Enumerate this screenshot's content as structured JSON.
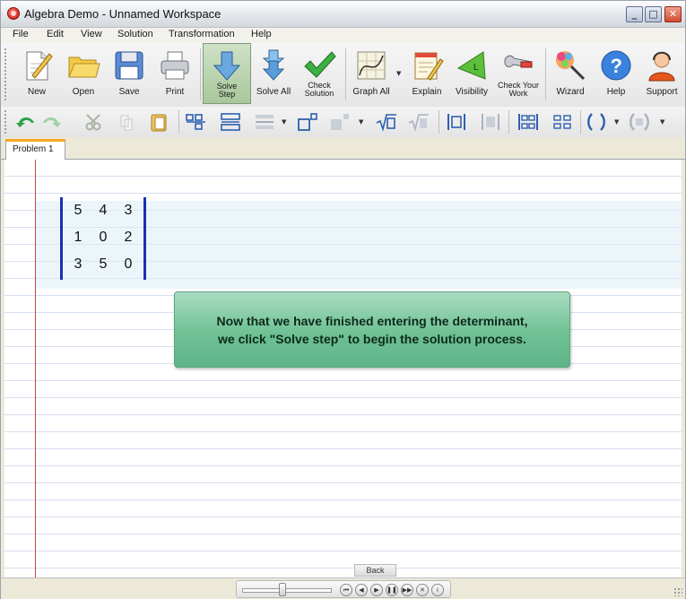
{
  "window": {
    "title": "Algebra Demo - Unnamed Workspace",
    "controls": {
      "minimize": "_",
      "maximize": "□",
      "close": "✕"
    }
  },
  "menu": [
    "File",
    "Edit",
    "View",
    "Solution",
    "Transformation",
    "Help"
  ],
  "toolbar_main": [
    {
      "label": "New",
      "icon": "new-document-icon"
    },
    {
      "label": "Open",
      "icon": "folder-icon"
    },
    {
      "label": "Save",
      "icon": "floppy-disk-icon"
    },
    {
      "label": "Print",
      "icon": "printer-icon"
    },
    {
      "label": "Solve Step",
      "icon": "down-arrow-icon",
      "active": true
    },
    {
      "label": "Solve All",
      "icon": "double-down-arrow-icon"
    },
    {
      "label": "Check Solution",
      "icon": "checkmark-icon"
    },
    {
      "label": "Graph All",
      "icon": "graph-icon"
    },
    {
      "label": "Explain",
      "icon": "notepad-pencil-icon"
    },
    {
      "label": "Visibility",
      "icon": "green-triangle-icon"
    },
    {
      "label": "Check Your Work",
      "icon": "wrench-icon"
    },
    {
      "label": "Wizard",
      "icon": "magic-wand-icon"
    },
    {
      "label": "Help",
      "icon": "question-mark-icon"
    },
    {
      "label": "Support",
      "icon": "support-person-icon"
    }
  ],
  "tabs": [
    {
      "label": "Problem 1",
      "active": true
    }
  ],
  "matrix": [
    [
      "5",
      "4",
      "3"
    ],
    [
      "1",
      "0",
      "2"
    ],
    [
      "3",
      "5",
      "0"
    ]
  ],
  "note": {
    "line1": "Now that we have finished entering the determinant,",
    "line2": "we click \"Solve step\" to begin the solution process."
  },
  "playback": {
    "back_label": "Back",
    "progress": 0.45
  },
  "colors": {
    "active_tool": "#b5d1a8",
    "note_bg": "#6fc194",
    "determinant_bar": "#1a2fb5",
    "margin_line": "#cc4444",
    "tab_accent": "#f5a623"
  }
}
